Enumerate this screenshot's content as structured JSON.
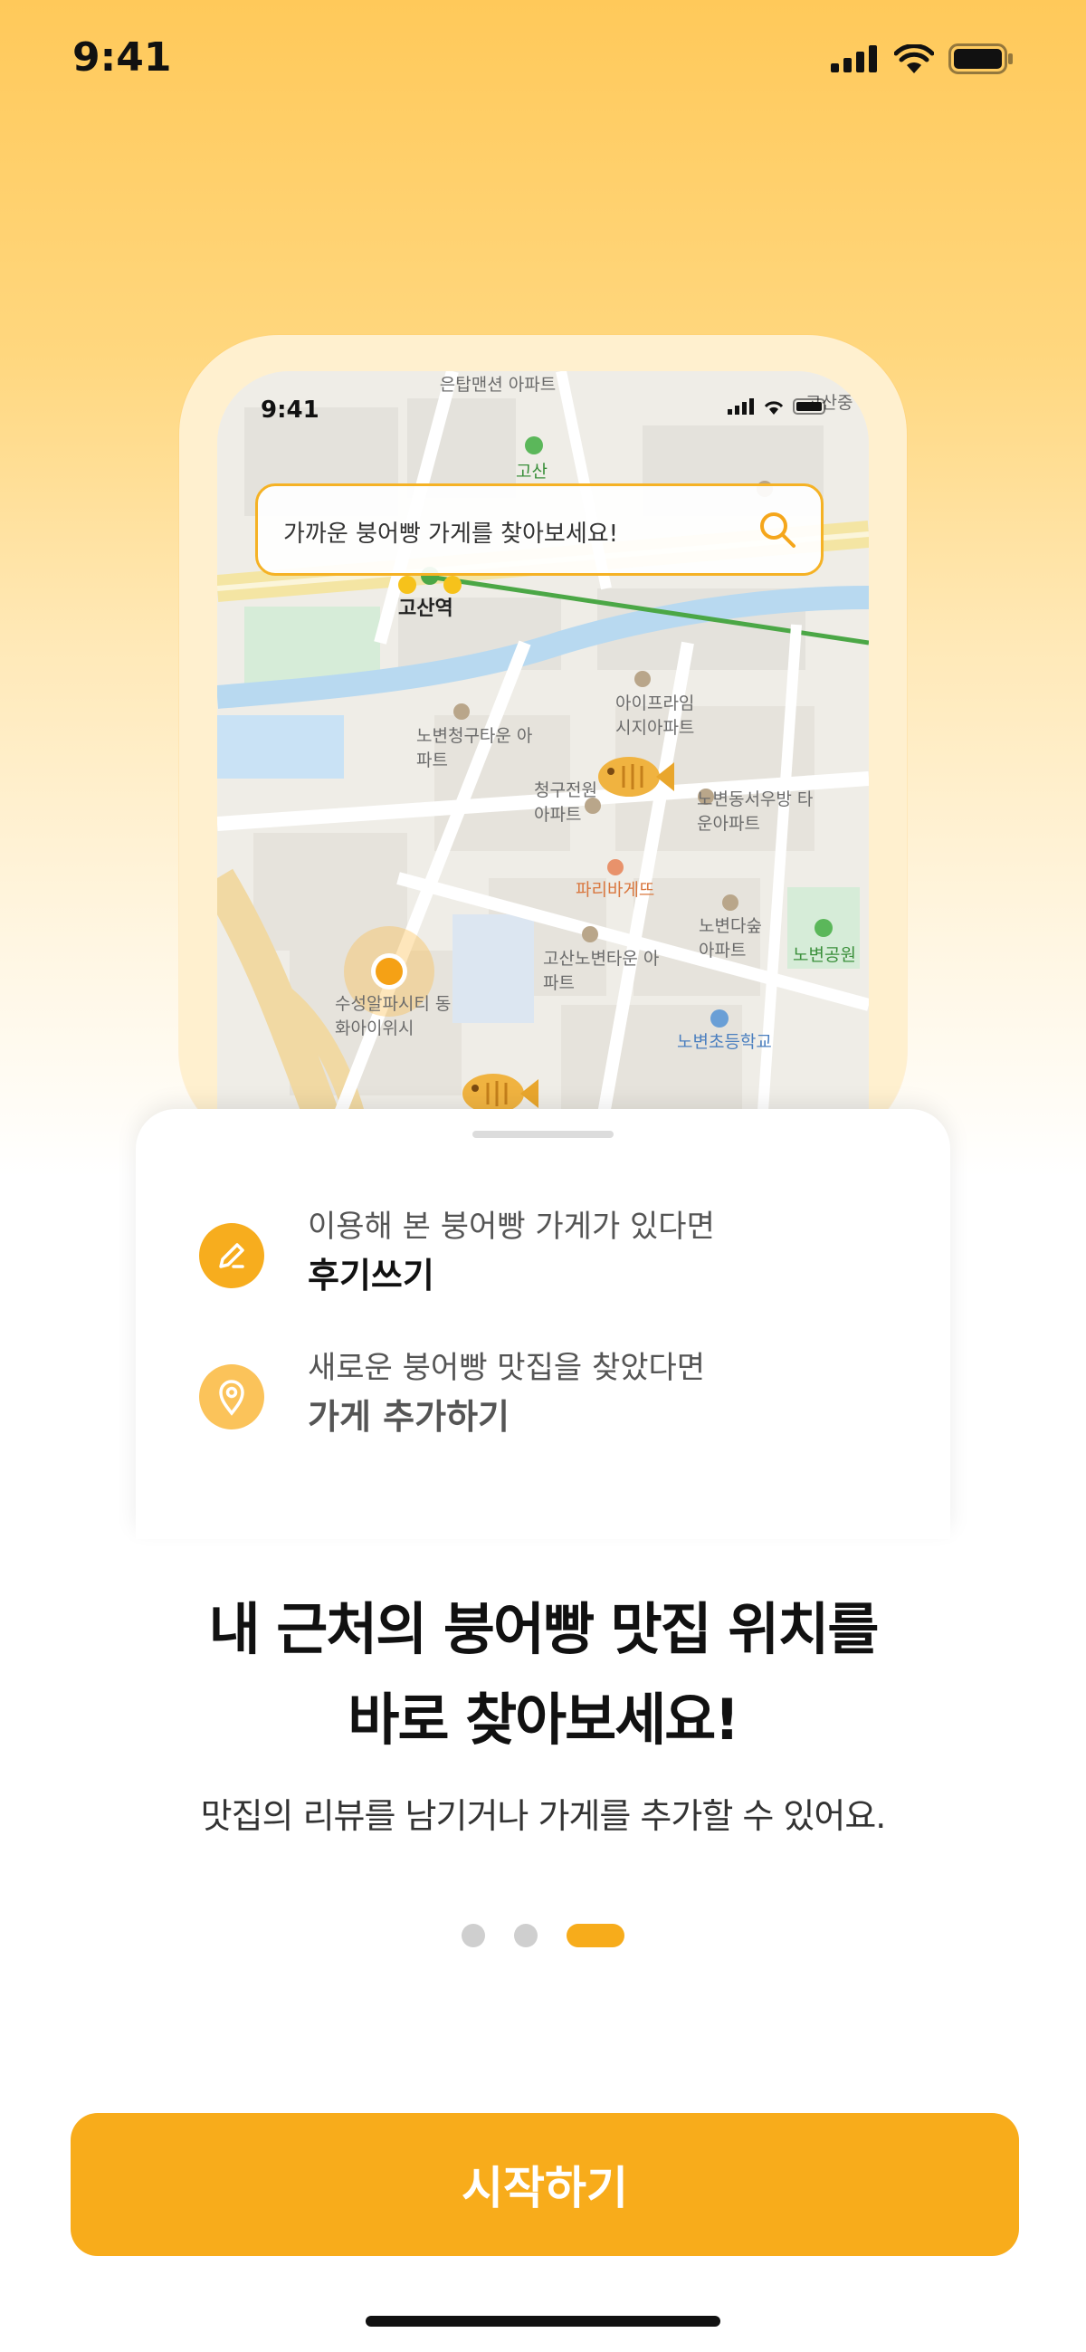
{
  "status_bar": {
    "time": "9:41",
    "icons": [
      "signal-icon",
      "wifi-icon",
      "battery-icon"
    ]
  },
  "map_preview": {
    "time": "9:41",
    "search_placeholder": "가까운 붕어빵 가게를 찾아보세요!",
    "labels": [
      "은탑맨션 아파트",
      "고산",
      "고산역",
      "아이프라임 시지아파트",
      "노변청구타운 아파트",
      "청구전원 아파트",
      "노변동서우방 타운아파트",
      "파리바게뜨",
      "노변다숲 아파트",
      "노변공원",
      "고산노변타운 아파트",
      "수성알파시티 동화아이위시",
      "노변초등학교",
      "고산중"
    ]
  },
  "sheet": {
    "features": [
      {
        "icon": "pencil-icon",
        "subtitle": "이용해 본 붕어빵 가게가 있다면",
        "title": "후기쓰기"
      },
      {
        "icon": "location-pin-icon",
        "subtitle": "새로운 붕어빵 맛집을 찾았다면",
        "title": "가게 추가하기"
      }
    ]
  },
  "headline": {
    "line1": "내 근처의 붕어빵 맛집 위치를",
    "line2": "바로 찾아보세요!"
  },
  "subline": "맛집의 리뷰를 남기거나 가게를 추가할 수 있어요.",
  "pagination": {
    "total": 3,
    "active": 3
  },
  "colors": {
    "accent": "#f8ac1b",
    "background_top": "#ffc95a"
  },
  "start_button": {
    "label": "시작하기"
  }
}
